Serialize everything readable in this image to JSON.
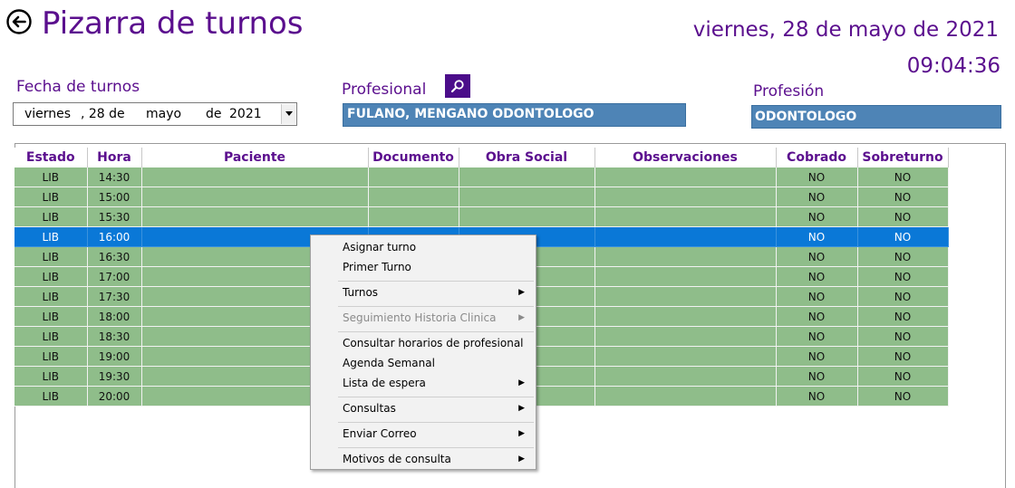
{
  "header": {
    "title": "Pizarra de turnos",
    "date_long": "viernes, 28 de mayo de 2021",
    "clock": "09:04:36",
    "back_icon": "circle-arrow-left-icon"
  },
  "filters": {
    "fecha_label": "Fecha de turnos",
    "fecha": {
      "weekday": "viernes",
      "day": ", 28 de",
      "month": "mayo",
      "de": "de",
      "year": "2021"
    },
    "profesional_label": "Profesional",
    "profesional_value": "FULANO, MENGANO ODONTOLOGO",
    "profesion_label": "Profesión",
    "profesion_value": "ODONTOLOGO",
    "search_icon": "magnifier-icon"
  },
  "grid": {
    "columns": [
      "Estado",
      "Hora",
      "Paciente",
      "Documento",
      "Obra Social",
      "Observaciones",
      "Cobrado",
      "Sobreturno"
    ],
    "rows": [
      [
        "LIB",
        "14:30",
        "",
        "",
        "",
        "",
        "NO",
        "NO"
      ],
      [
        "LIB",
        "15:00",
        "",
        "",
        "",
        "",
        "NO",
        "NO"
      ],
      [
        "LIB",
        "15:30",
        "",
        "",
        "",
        "",
        "NO",
        "NO"
      ],
      [
        "LIB",
        "16:00",
        "",
        "",
        "",
        "",
        "NO",
        "NO"
      ],
      [
        "LIB",
        "16:30",
        "",
        "",
        "",
        "",
        "NO",
        "NO"
      ],
      [
        "LIB",
        "17:00",
        "",
        "",
        "",
        "",
        "NO",
        "NO"
      ],
      [
        "LIB",
        "17:30",
        "",
        "",
        "",
        "",
        "NO",
        "NO"
      ],
      [
        "LIB",
        "18:00",
        "",
        "",
        "",
        "",
        "NO",
        "NO"
      ],
      [
        "LIB",
        "18:30",
        "",
        "",
        "",
        "",
        "NO",
        "NO"
      ],
      [
        "LIB",
        "19:00",
        "",
        "",
        "",
        "",
        "NO",
        "NO"
      ],
      [
        "LIB",
        "19:30",
        "",
        "",
        "",
        "",
        "NO",
        "NO"
      ],
      [
        "LIB",
        "20:00",
        "",
        "",
        "",
        "",
        "NO",
        "NO"
      ]
    ],
    "selected_row": 3,
    "colors": {
      "row": "#8fbd8a",
      "selected": "#0a78d7",
      "header_text": "#5b0f8e"
    }
  },
  "context_menu": {
    "items": [
      {
        "label": "Asignar turno",
        "submenu": false,
        "disabled": false
      },
      {
        "label": "Primer Turno",
        "submenu": false,
        "disabled": false
      },
      {
        "label": "Turnos",
        "submenu": true,
        "disabled": false
      },
      {
        "label": "Seguimiento Historia Clinica",
        "submenu": true,
        "disabled": true
      },
      {
        "label": "Consultar horarios de profesional",
        "submenu": false,
        "disabled": false
      },
      {
        "label": "Agenda Semanal",
        "submenu": false,
        "disabled": false
      },
      {
        "label": "Lista de espera",
        "submenu": true,
        "disabled": false
      },
      {
        "label": "Consultas",
        "submenu": true,
        "disabled": false
      },
      {
        "label": "Enviar Correo",
        "submenu": true,
        "disabled": false
      },
      {
        "label": "Motivos de consulta",
        "submenu": true,
        "disabled": false
      }
    ]
  }
}
